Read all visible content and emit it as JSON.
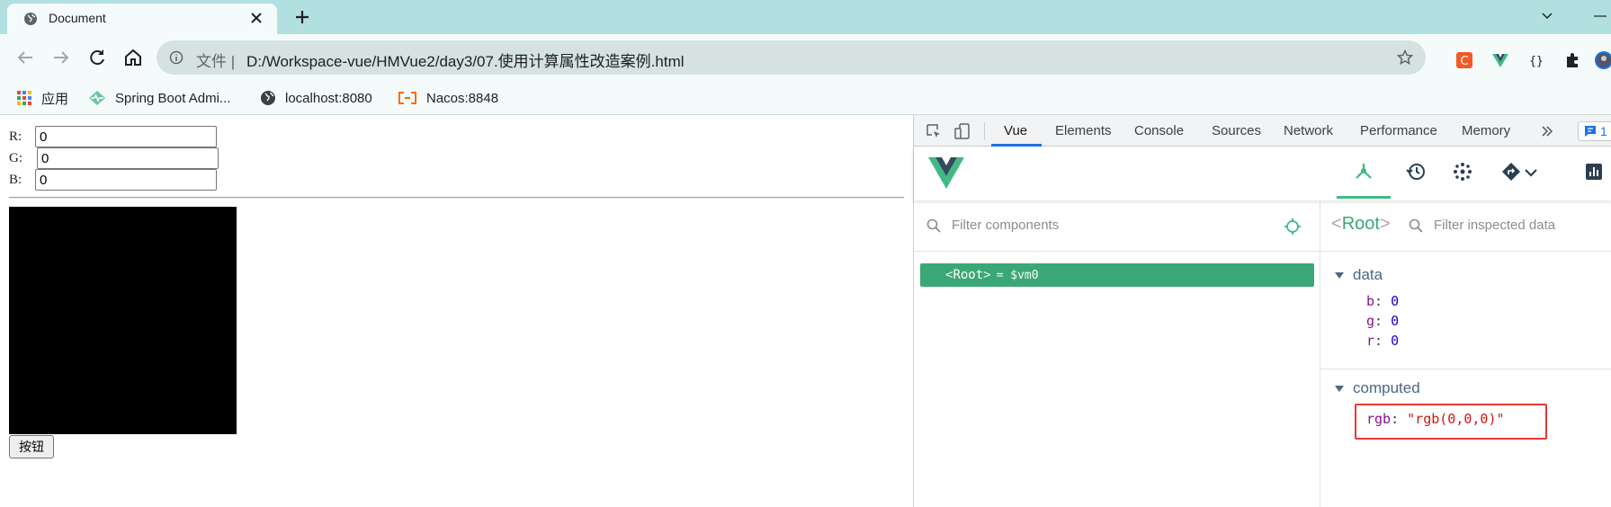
{
  "browser": {
    "tab_title": "Document",
    "address_scheme": "文件",
    "address_url": "D:/Workspace-vue/HMVue2/day3/07.使用计算属性改造案例.html",
    "bookmarks": [
      {
        "label": "应用",
        "icon": "apps-grid-icon"
      },
      {
        "label": "Spring Boot Admi...",
        "icon": "pulse-icon"
      },
      {
        "label": "localhost:8080",
        "icon": "globe-icon"
      },
      {
        "label": "Nacos:8848",
        "icon": "bracket-icon"
      }
    ],
    "extensions": [
      {
        "name": "c-extension-icon",
        "color": "#f15a24"
      },
      {
        "name": "vue-devtools-icon",
        "color": "#42b983"
      },
      {
        "name": "json-braces-icon",
        "color": "#202124"
      },
      {
        "name": "puzzle-icon",
        "color": "#202124"
      }
    ]
  },
  "page": {
    "r_label": "R:",
    "g_label": "G:",
    "b_label": "B:",
    "r_value": "0",
    "g_value": "0",
    "b_value": "0",
    "swatch_color": "#000000",
    "button_label": "按钮"
  },
  "devtools": {
    "tabs": [
      {
        "label": "Vue",
        "active": true
      },
      {
        "label": "Elements"
      },
      {
        "label": "Console"
      },
      {
        "label": "Sources"
      },
      {
        "label": "Network"
      },
      {
        "label": "Performance"
      },
      {
        "label": "Memory"
      }
    ],
    "issues_count": "1",
    "filter_components_placeholder": "Filter components",
    "root_row": {
      "open": "<",
      "name": "Root",
      "close": ">",
      "assign": "= $vm0"
    },
    "inspector": {
      "open": "<",
      "name": "Root",
      "close": ">",
      "filter_placeholder": "Filter inspected data",
      "data_title": "data",
      "data": [
        {
          "key": "b",
          "value": "0"
        },
        {
          "key": "g",
          "value": "0"
        },
        {
          "key": "r",
          "value": "0"
        }
      ],
      "computed_title": "computed",
      "computed": [
        {
          "key": "rgb",
          "value": "\"rgb(0,0,0)\""
        }
      ]
    },
    "accent_color": "#42b983"
  }
}
